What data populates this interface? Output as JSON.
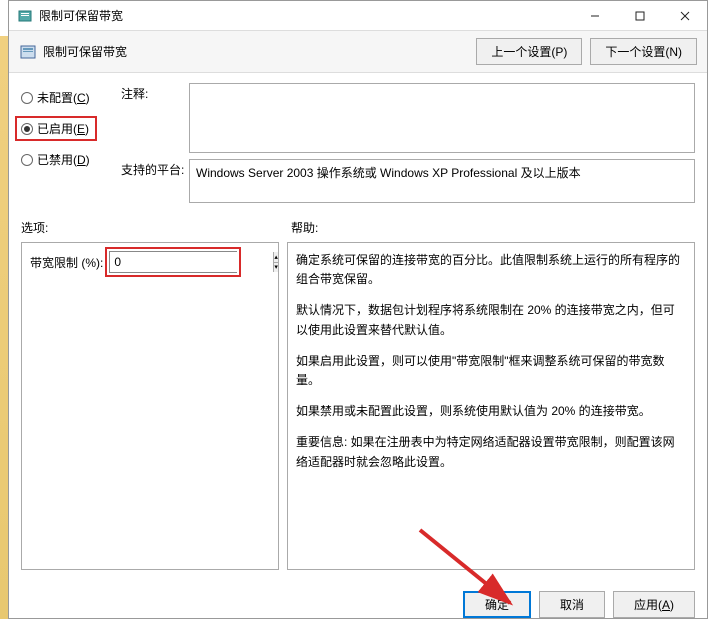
{
  "window": {
    "title": "限制可保留带宽",
    "toolbar_title": "限制可保留带宽"
  },
  "toolbar": {
    "prev_btn": "上一个设置(P)",
    "next_btn": "下一个设置(N)"
  },
  "radios": {
    "not_configured_label": "未配置(C)",
    "enabled_label": "已启用(E)",
    "disabled_label": "已禁用(D)"
  },
  "fields": {
    "comment_label": "注释:",
    "platform_label": "支持的平台:",
    "platform_text": "Windows Server 2003 操作系统或 Windows XP Professional 及以上版本"
  },
  "labels": {
    "options": "选项:",
    "help": "帮助:"
  },
  "options": {
    "limit_label": "带宽限制 (%):",
    "limit_value": "0"
  },
  "help": {
    "p1": "确定系统可保留的连接带宽的百分比。此值限制系统上运行的所有程序的组合带宽保留。",
    "p2": "默认情况下，数据包计划程序将系统限制在 20% 的连接带宽之内，但可以使用此设置来替代默认值。",
    "p3": "如果启用此设置，则可以使用\"带宽限制\"框来调整系统可保留的带宽数量。",
    "p4": "如果禁用或未配置此设置，则系统使用默认值为 20% 的连接带宽。",
    "p5": "重要信息: 如果在注册表中为特定网络适配器设置带宽限制，则配置该网络适配器时就会忽略此设置。"
  },
  "footer": {
    "ok": "确定",
    "cancel": "取消",
    "apply": "应用(A)"
  }
}
